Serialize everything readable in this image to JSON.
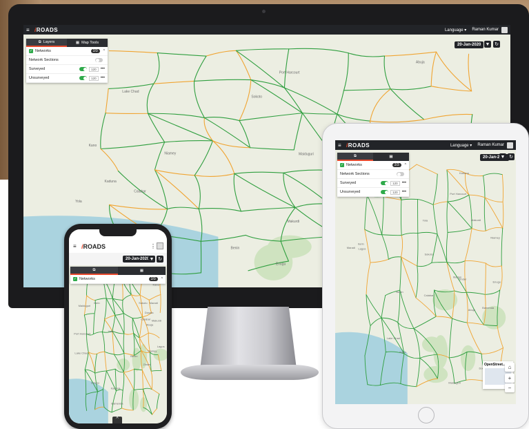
{
  "app": {
    "logo_prefix": "i",
    "logo_rest": "ROADS",
    "language_label": "Language ▾",
    "user_name": "Raman Kumar",
    "date": "20-Jan-2020"
  },
  "panel": {
    "tab_layers": "Layers",
    "tab_map_tools": "Map Tools",
    "networks_label": "Networks",
    "networks_count": "2/3",
    "rows": [
      {
        "label": "Network Sections",
        "on": false,
        "count": ""
      },
      {
        "label": "Surveyed",
        "on": true,
        "count": "120"
      },
      {
        "label": "Unsurveyed",
        "on": true,
        "count": "120"
      }
    ]
  },
  "map": {
    "places": [
      "Niamey",
      "Maradi",
      "Zinder",
      "Sokoto",
      "Kano",
      "Maiduguri",
      "Kaduna",
      "Abuja",
      "Makurdi",
      "Enugu",
      "Port Harcourt",
      "Calabar",
      "Yola",
      "Benin",
      "Lagos",
      "Ibadan",
      "Ilorin",
      "Douala",
      "Bamenda",
      "Lake Chad"
    ],
    "overview_label": "OpenStreet...",
    "zoom_in": "+",
    "zoom_out": "−"
  },
  "colors": {
    "surveyed": "#2e9e3e",
    "unsurveyed": "#f0a431",
    "accent": "#e8492d",
    "appbar": "#222428"
  }
}
